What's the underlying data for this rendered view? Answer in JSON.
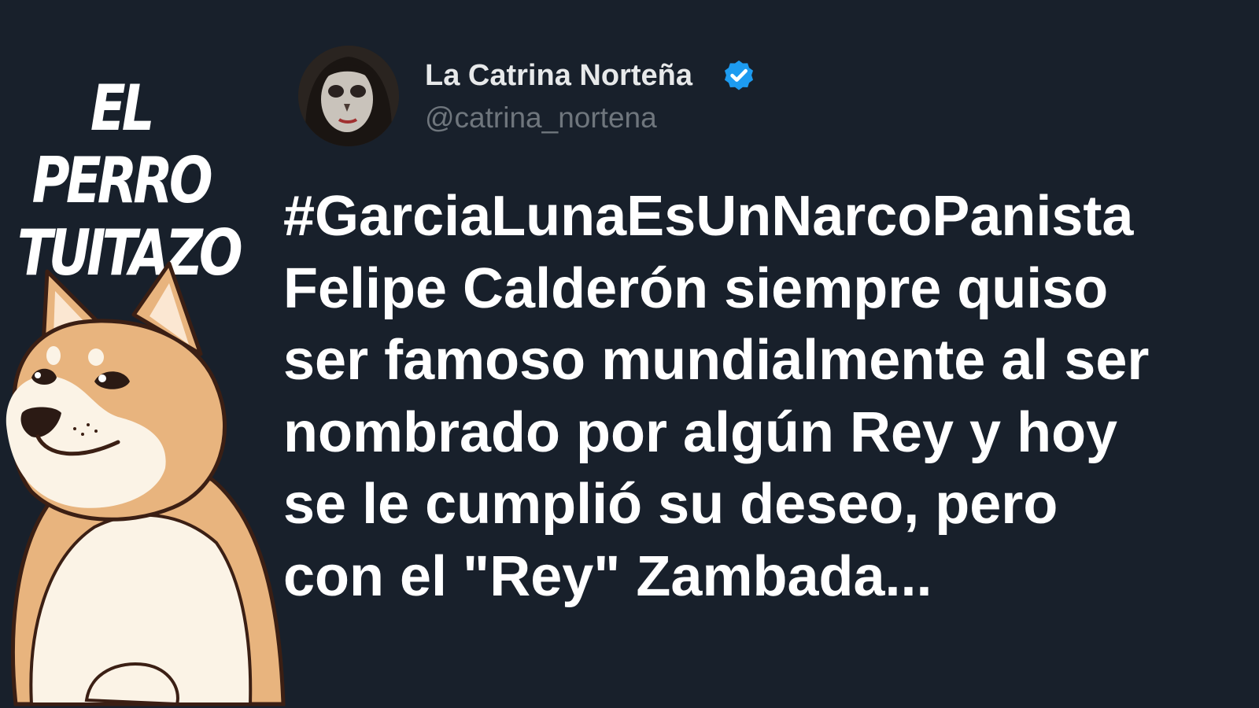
{
  "brand": {
    "line1": "EL PERRO",
    "line2": "TUITAZO"
  },
  "profile": {
    "display_name": "La Catrina Norteña",
    "handle": "@catrina_nortena"
  },
  "tweet": {
    "lines": [
      "#GarciaLunaEsUnNarcoPanista",
      "Felipe Calderón siempre quiso",
      "ser famoso mundialmente al ser",
      "nombrado por algún Rey y hoy",
      "se le cumplió su deseo, pero",
      "con el \"Rey\" Zambada..."
    ]
  },
  "icons": {
    "verified": "verified-badge-icon",
    "mascot": "shiba-dog-mascot"
  },
  "colors": {
    "background": "#18202b",
    "verified": "#1d9bf0",
    "tweet_text": "#ffffff",
    "handle": "#6f767d"
  }
}
